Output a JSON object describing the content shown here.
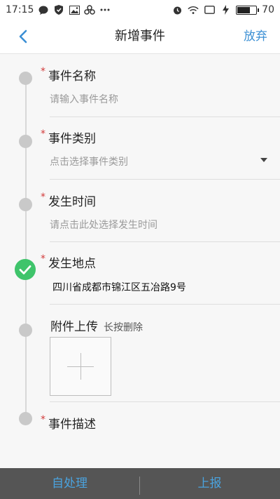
{
  "status_bar": {
    "time": "17:15",
    "battery_level": "70",
    "battery_fraction": 0.7,
    "left_icons": [
      "chat-bubble-icon",
      "shield-icon",
      "image-icon",
      "link-icon",
      "more-icon"
    ],
    "right_icons": [
      "alarm-icon",
      "wifi-icon",
      "screen-icon",
      "charging-icon"
    ]
  },
  "nav": {
    "title": "新增事件",
    "right_action": "放弃",
    "accent_color": "#3b8fd4"
  },
  "form": {
    "event_name": {
      "label": "事件名称",
      "placeholder": "请输入事件名称",
      "required": true
    },
    "event_type": {
      "label": "事件类别",
      "placeholder": "点击选择事件类别",
      "required": true
    },
    "occur_time": {
      "label": "发生时间",
      "placeholder": "请点击此处选择发生时间",
      "required": true
    },
    "occur_place": {
      "label": "发生地点",
      "value": "四川省成都市锦江区五冶路9号",
      "required": true
    },
    "attachment": {
      "label": "附件上传",
      "hint": "长按删除"
    },
    "description": {
      "label": "事件描述",
      "required": true
    },
    "required_mark": "*"
  },
  "bottom_bar": {
    "self_handle": "自处理",
    "report": "上报"
  }
}
